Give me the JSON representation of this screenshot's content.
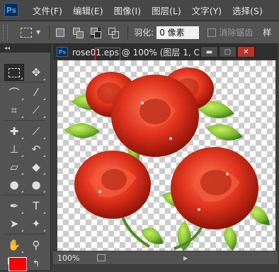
{
  "app": {
    "logo": "Ps"
  },
  "menubar": {
    "items": [
      "文件(F)",
      "编辑(E)",
      "图像(I)",
      "图层(L)",
      "文字(Y)",
      "选择(S)"
    ]
  },
  "options": {
    "feather_label": "羽化:",
    "feather_value": "0 像素",
    "antialias_label": "消除锯齿",
    "style_label": "样"
  },
  "toolbox": {
    "tools": [
      "rect-marquee",
      "move",
      "lasso",
      "magic-wand",
      "crop",
      "eyedropper",
      "healing-brush",
      "brush",
      "clone-stamp",
      "history-brush",
      "eraser",
      "paint-bucket",
      "blur",
      "dodge",
      "pen",
      "type",
      "path-selection",
      "custom-shape",
      "hand",
      "zoom"
    ],
    "foreground_color": "#ff0000"
  },
  "document": {
    "icon": "Ps",
    "filename": "rose01.eps",
    "title_rest": " @ 100% (图层 1, C...",
    "zoom": "100%",
    "highlight_color": "#e53935"
  }
}
